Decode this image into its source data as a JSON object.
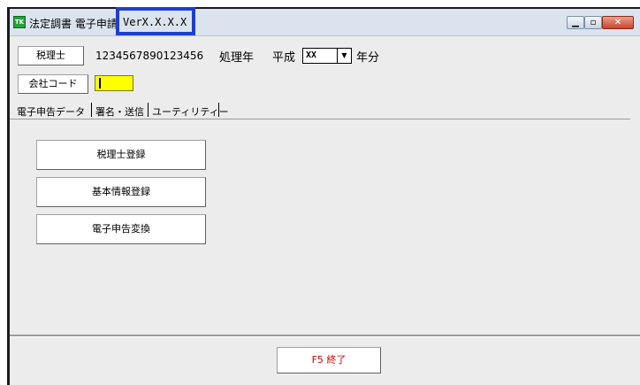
{
  "window": {
    "title": "法定調書 電子申請",
    "version": "VerX.X.X.X",
    "app_icon_text": "TK"
  },
  "header": {
    "tax_accountant_button": "税理士",
    "tax_accountant_id": "1234567890123456",
    "processing_year_label": "処理年",
    "era_label": "平成",
    "year_select_value": "XX",
    "year_suffix": "年分",
    "company_code_button": "会社コード",
    "company_code_value": ""
  },
  "tabs": [
    {
      "label": "電子申告データ",
      "active": true
    },
    {
      "label": "署名・送信",
      "active": false
    },
    {
      "label": "ユーティリティー",
      "active": false
    }
  ],
  "actions": {
    "register_accountant": "税理士登録",
    "register_basic_info": "基本情報登録",
    "convert_e_filing": "電子申告変換"
  },
  "footer": {
    "exit_button": "F5 終了"
  },
  "colors": {
    "highlight_box": "#1e3fcf",
    "input_highlight": "#ffff00",
    "exit_text": "#d00000"
  }
}
